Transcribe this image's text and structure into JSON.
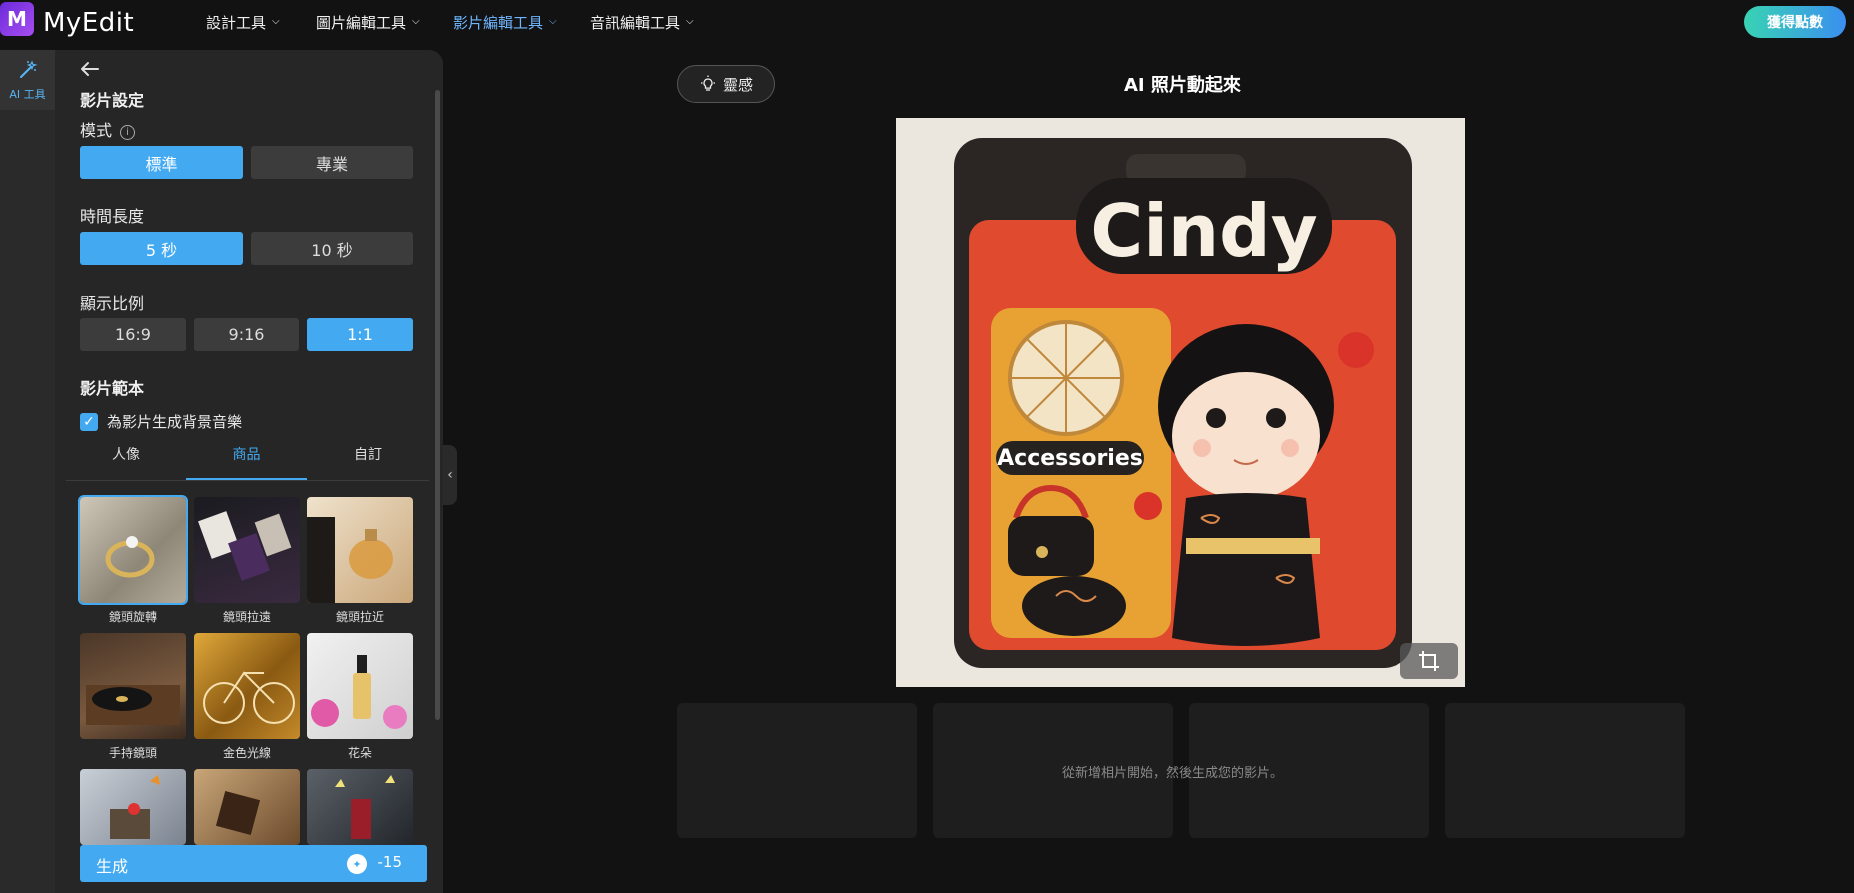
{
  "app": {
    "logo_mark": "M",
    "name": "MyEdit"
  },
  "nav": [
    {
      "label": "設計工具",
      "active": false
    },
    {
      "label": "圖片編輯工具",
      "active": false
    },
    {
      "label": "影片編輯工具",
      "active": true
    },
    {
      "label": "音訊編輯工具",
      "active": false
    }
  ],
  "header_button": "獲得點數",
  "rail": {
    "item_label": "AI 工具",
    "icon": "magic-wand-icon"
  },
  "panel": {
    "section_title": "影片設定",
    "mode": {
      "label": "模式",
      "options": [
        "標準",
        "專業"
      ],
      "selected": "標準"
    },
    "duration": {
      "label": "時間長度",
      "options": [
        "5 秒",
        "10 秒"
      ],
      "selected": "5 秒"
    },
    "ratio": {
      "label": "顯示比例",
      "options": [
        "16:9",
        "9:16",
        "1:1"
      ],
      "selected": "1:1"
    },
    "template": {
      "label": "影片範本",
      "bgm_checkbox": "為影片生成背景音樂",
      "bgm_checked": true,
      "tabs": [
        "人像",
        "商品",
        "自訂"
      ],
      "active_tab": "商品",
      "items": [
        "鏡頭旋轉",
        "鏡頭拉遠",
        "鏡頭拉近",
        "手持鏡頭",
        "金色光線",
        "花朵"
      ]
    },
    "generate": {
      "label": "生成",
      "cost": "-15"
    }
  },
  "main": {
    "inspire_button": "靈感",
    "title": "AI 照片動起來",
    "image_text": {
      "header": "Cindy",
      "badge": "Accessories"
    },
    "empty_hint": "從新增相片開始，然後生成您的影片。"
  }
}
